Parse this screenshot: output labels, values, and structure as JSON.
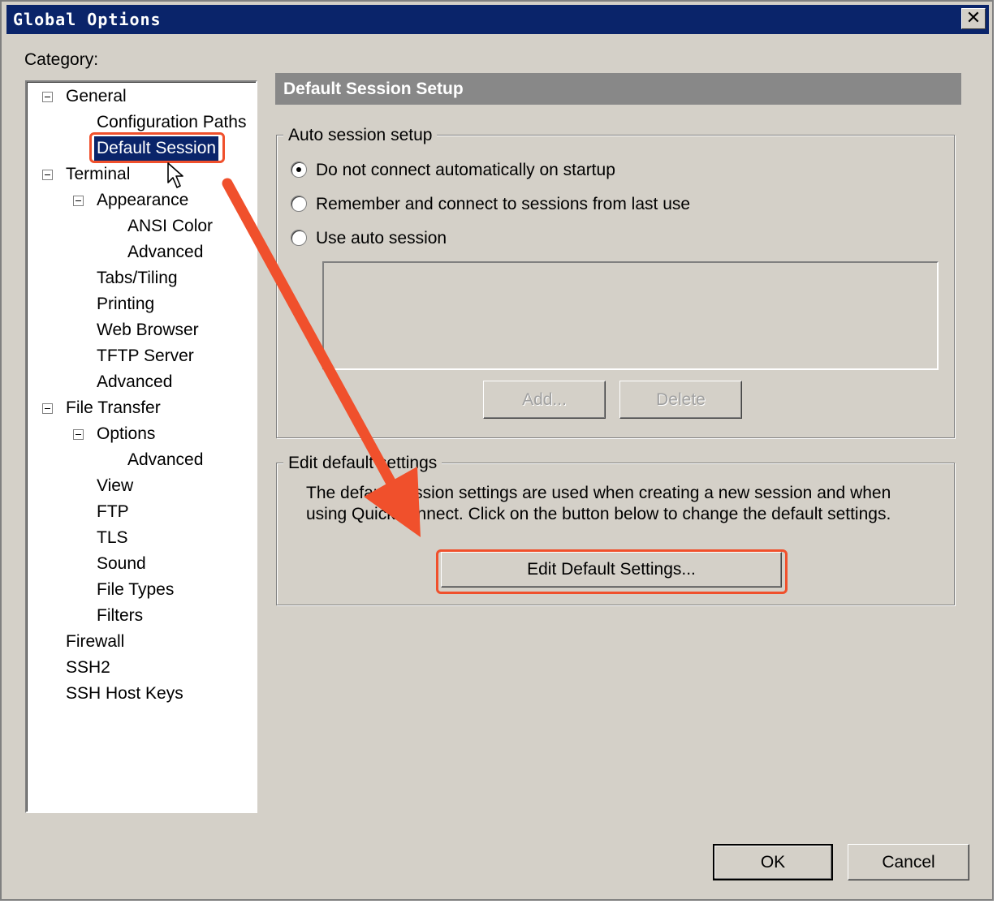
{
  "window": {
    "title": "Global Options",
    "close_symbol": "✕"
  },
  "category": {
    "label": "Category:"
  },
  "tree": {
    "items": [
      {
        "label": "General",
        "expanded": true
      },
      {
        "label": "Configuration Paths"
      },
      {
        "label": "Default Session",
        "selected": true
      },
      {
        "label": "Terminal",
        "expanded": true
      },
      {
        "label": "Appearance",
        "expanded": true
      },
      {
        "label": "ANSI Color"
      },
      {
        "label": "Advanced"
      },
      {
        "label": "Tabs/Tiling"
      },
      {
        "label": "Printing"
      },
      {
        "label": "Web Browser"
      },
      {
        "label": "TFTP Server"
      },
      {
        "label": "Advanced"
      },
      {
        "label": "File Transfer",
        "expanded": true
      },
      {
        "label": "Options",
        "expanded": true
      },
      {
        "label": "Advanced"
      },
      {
        "label": "View"
      },
      {
        "label": "FTP"
      },
      {
        "label": "TLS"
      },
      {
        "label": "Sound"
      },
      {
        "label": "File Types"
      },
      {
        "label": "Filters"
      },
      {
        "label": "Firewall"
      },
      {
        "label": "SSH2"
      },
      {
        "label": "SSH Host Keys"
      }
    ]
  },
  "panel": {
    "header": "Default Session Setup",
    "auto_session": {
      "legend": "Auto session setup",
      "options": [
        {
          "label": "Do not connect automatically on startup",
          "checked": true
        },
        {
          "label": "Remember and connect to sessions from last use",
          "checked": false
        },
        {
          "label": "Use auto session",
          "checked": false
        }
      ],
      "add_label": "Add...",
      "delete_label": "Delete"
    },
    "edit_defaults": {
      "legend": "Edit default settings",
      "description": "The default session settings are used when creating a new session and when\nusing QuickConnect.  Click on the button below to change the default settings.",
      "button_label": "Edit Default Settings..."
    }
  },
  "footer": {
    "ok_label": "OK",
    "cancel_label": "Cancel"
  },
  "colors": {
    "annotation": "#f0502c",
    "titlebar": "#0a246a",
    "selection": "#0a246a",
    "dialog_bg": "#d4d0c8"
  }
}
